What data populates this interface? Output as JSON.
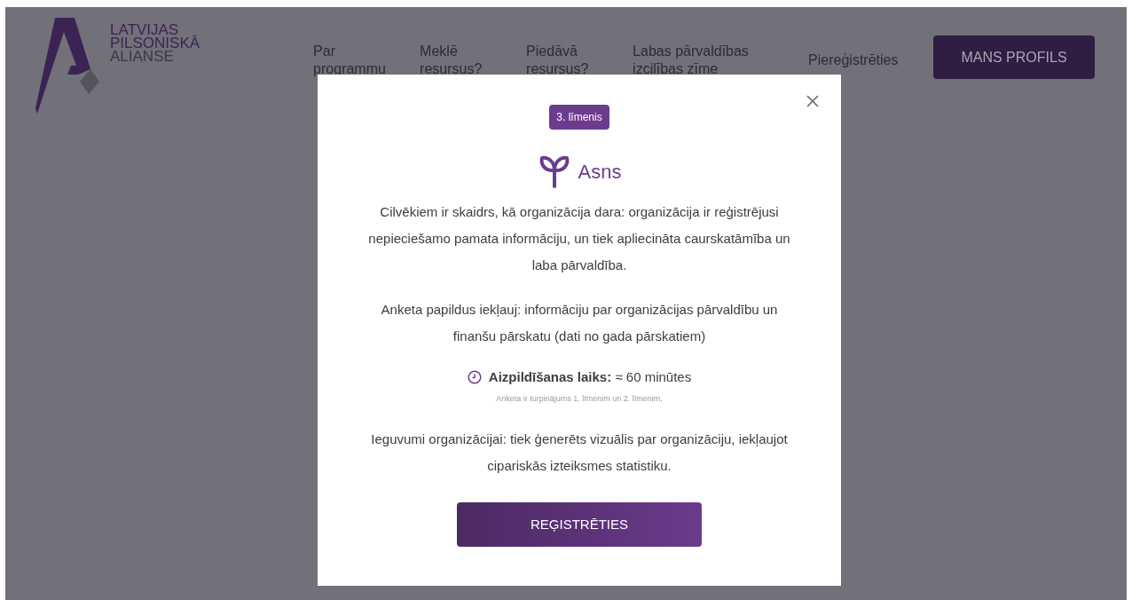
{
  "logo": {
    "lines": [
      "LATVIJAS",
      "PILSONISKĀ",
      "ALIANSE"
    ]
  },
  "nav": [
    {
      "label": "Par programmu"
    },
    {
      "label": "Meklē resursus?"
    },
    {
      "label": "Piedāvā resursus?"
    },
    {
      "label": "Labas pārvaldības izcilības zīme"
    },
    {
      "label": "Piereģistrēties"
    }
  ],
  "profile_button": "MANS PROFILS",
  "modal": {
    "badge": "3. līmenis",
    "level_name": "Asns",
    "description": "Cilvēkiem ir skaidrs, kā organizācija dara: organizācija ir reģistrējusi nepieciešamo pamata informāciju, un tiek apliecināta caurskatāmība un laba pārvaldība.",
    "includes": "Anketa papildus iekļauj: informāciju par organizācijas pārvaldību un finanšu pārskatu (dati no gada pārskatiem)",
    "time": "**Aizpildīšanas laiks:** ≈ 60 minūtes",
    "note": "Anketa ir turpinājums 1. līmenim un 2. līmenim.",
    "benefits": "Ieguvumi organizācijai: tiek ģenerēts vizuālis par organizāciju, iekļaujot cipariskās izteiksmes statistiku.",
    "button": "REĢISTRĒTIES"
  }
}
